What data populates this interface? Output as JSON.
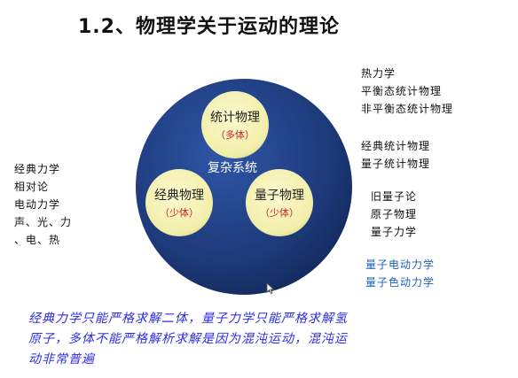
{
  "title": "1.2、物理学关于运动的理论",
  "left_list": [
    "经典力学",
    "相对论",
    "电动力学",
    "声、光、力",
    "、电、热"
  ],
  "right_lists": {
    "thermo": [
      "热力学",
      "平衡态统计物理",
      "非平衡态统计物理"
    ],
    "statistical": [
      "经典统计物理",
      "量子统计物理"
    ],
    "quantum": [
      "旧量子论",
      "原子物理",
      "量子力学"
    ],
    "field": [
      "量子电动力学",
      "量子色动力学"
    ]
  },
  "diagram": {
    "center_label": "复杂系统",
    "circles": [
      {
        "label": "统计物理",
        "sub": "（多体）"
      },
      {
        "label": "经典物理",
        "sub": "（少体）"
      },
      {
        "label": "量子物理",
        "sub": "（少体）"
      }
    ]
  },
  "footer": [
    "经典力学只能严格求解二体，量子力学只能严格求解氢",
    "原子，多体不能严格解析求解是因为混沌运动，混沌运",
    "动非常普遍"
  ],
  "colors": {
    "big_circle": "#1d3a7a",
    "small_circle": "#f2eeaa",
    "sub_label": "#cc2222",
    "blue_list": "#1f62b8",
    "footer_text": "#2c2ce6"
  }
}
